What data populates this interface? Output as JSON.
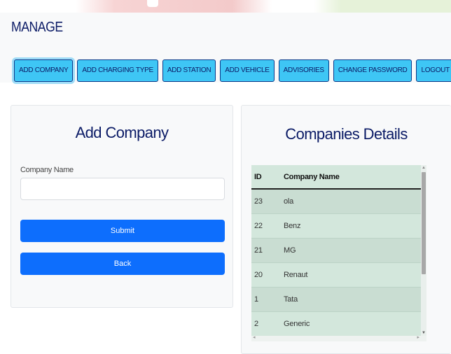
{
  "header": {
    "brand": "MANAGE",
    "nav": [
      {
        "label": "ADD COMPANY",
        "active": true
      },
      {
        "label": "ADD CHARGING TYPE",
        "active": false
      },
      {
        "label": "ADD STATION",
        "active": false
      },
      {
        "label": "ADD VEHICLE",
        "active": false
      },
      {
        "label": "ADVISORIES",
        "active": false
      },
      {
        "label": "CHANGE PASSWORD",
        "active": false
      },
      {
        "label": "LOGOUT",
        "active": false
      }
    ]
  },
  "form": {
    "title": "Add Company",
    "company_name_label": "Company Name",
    "company_name_value": "",
    "submit_label": "Submit",
    "back_label": "Back"
  },
  "details": {
    "title": "Companies Details",
    "columns": [
      "ID",
      "Company Name"
    ],
    "rows": [
      {
        "id": "23",
        "name": "ola"
      },
      {
        "id": "22",
        "name": "Benz"
      },
      {
        "id": "21",
        "name": "MG"
      },
      {
        "id": "20",
        "name": "Renaut"
      },
      {
        "id": "1",
        "name": "Tata"
      },
      {
        "id": "2",
        "name": "Generic"
      }
    ]
  },
  "colors": {
    "brand_text": "#0b1b66",
    "nav_button": "#3ec6f5",
    "primary_button": "#0d6efd",
    "table_bg": "#d3e7dc"
  },
  "icons": {
    "scroll_up": "▲",
    "scroll_down": "▼",
    "scroll_left": "◂",
    "scroll_right": "▸"
  }
}
